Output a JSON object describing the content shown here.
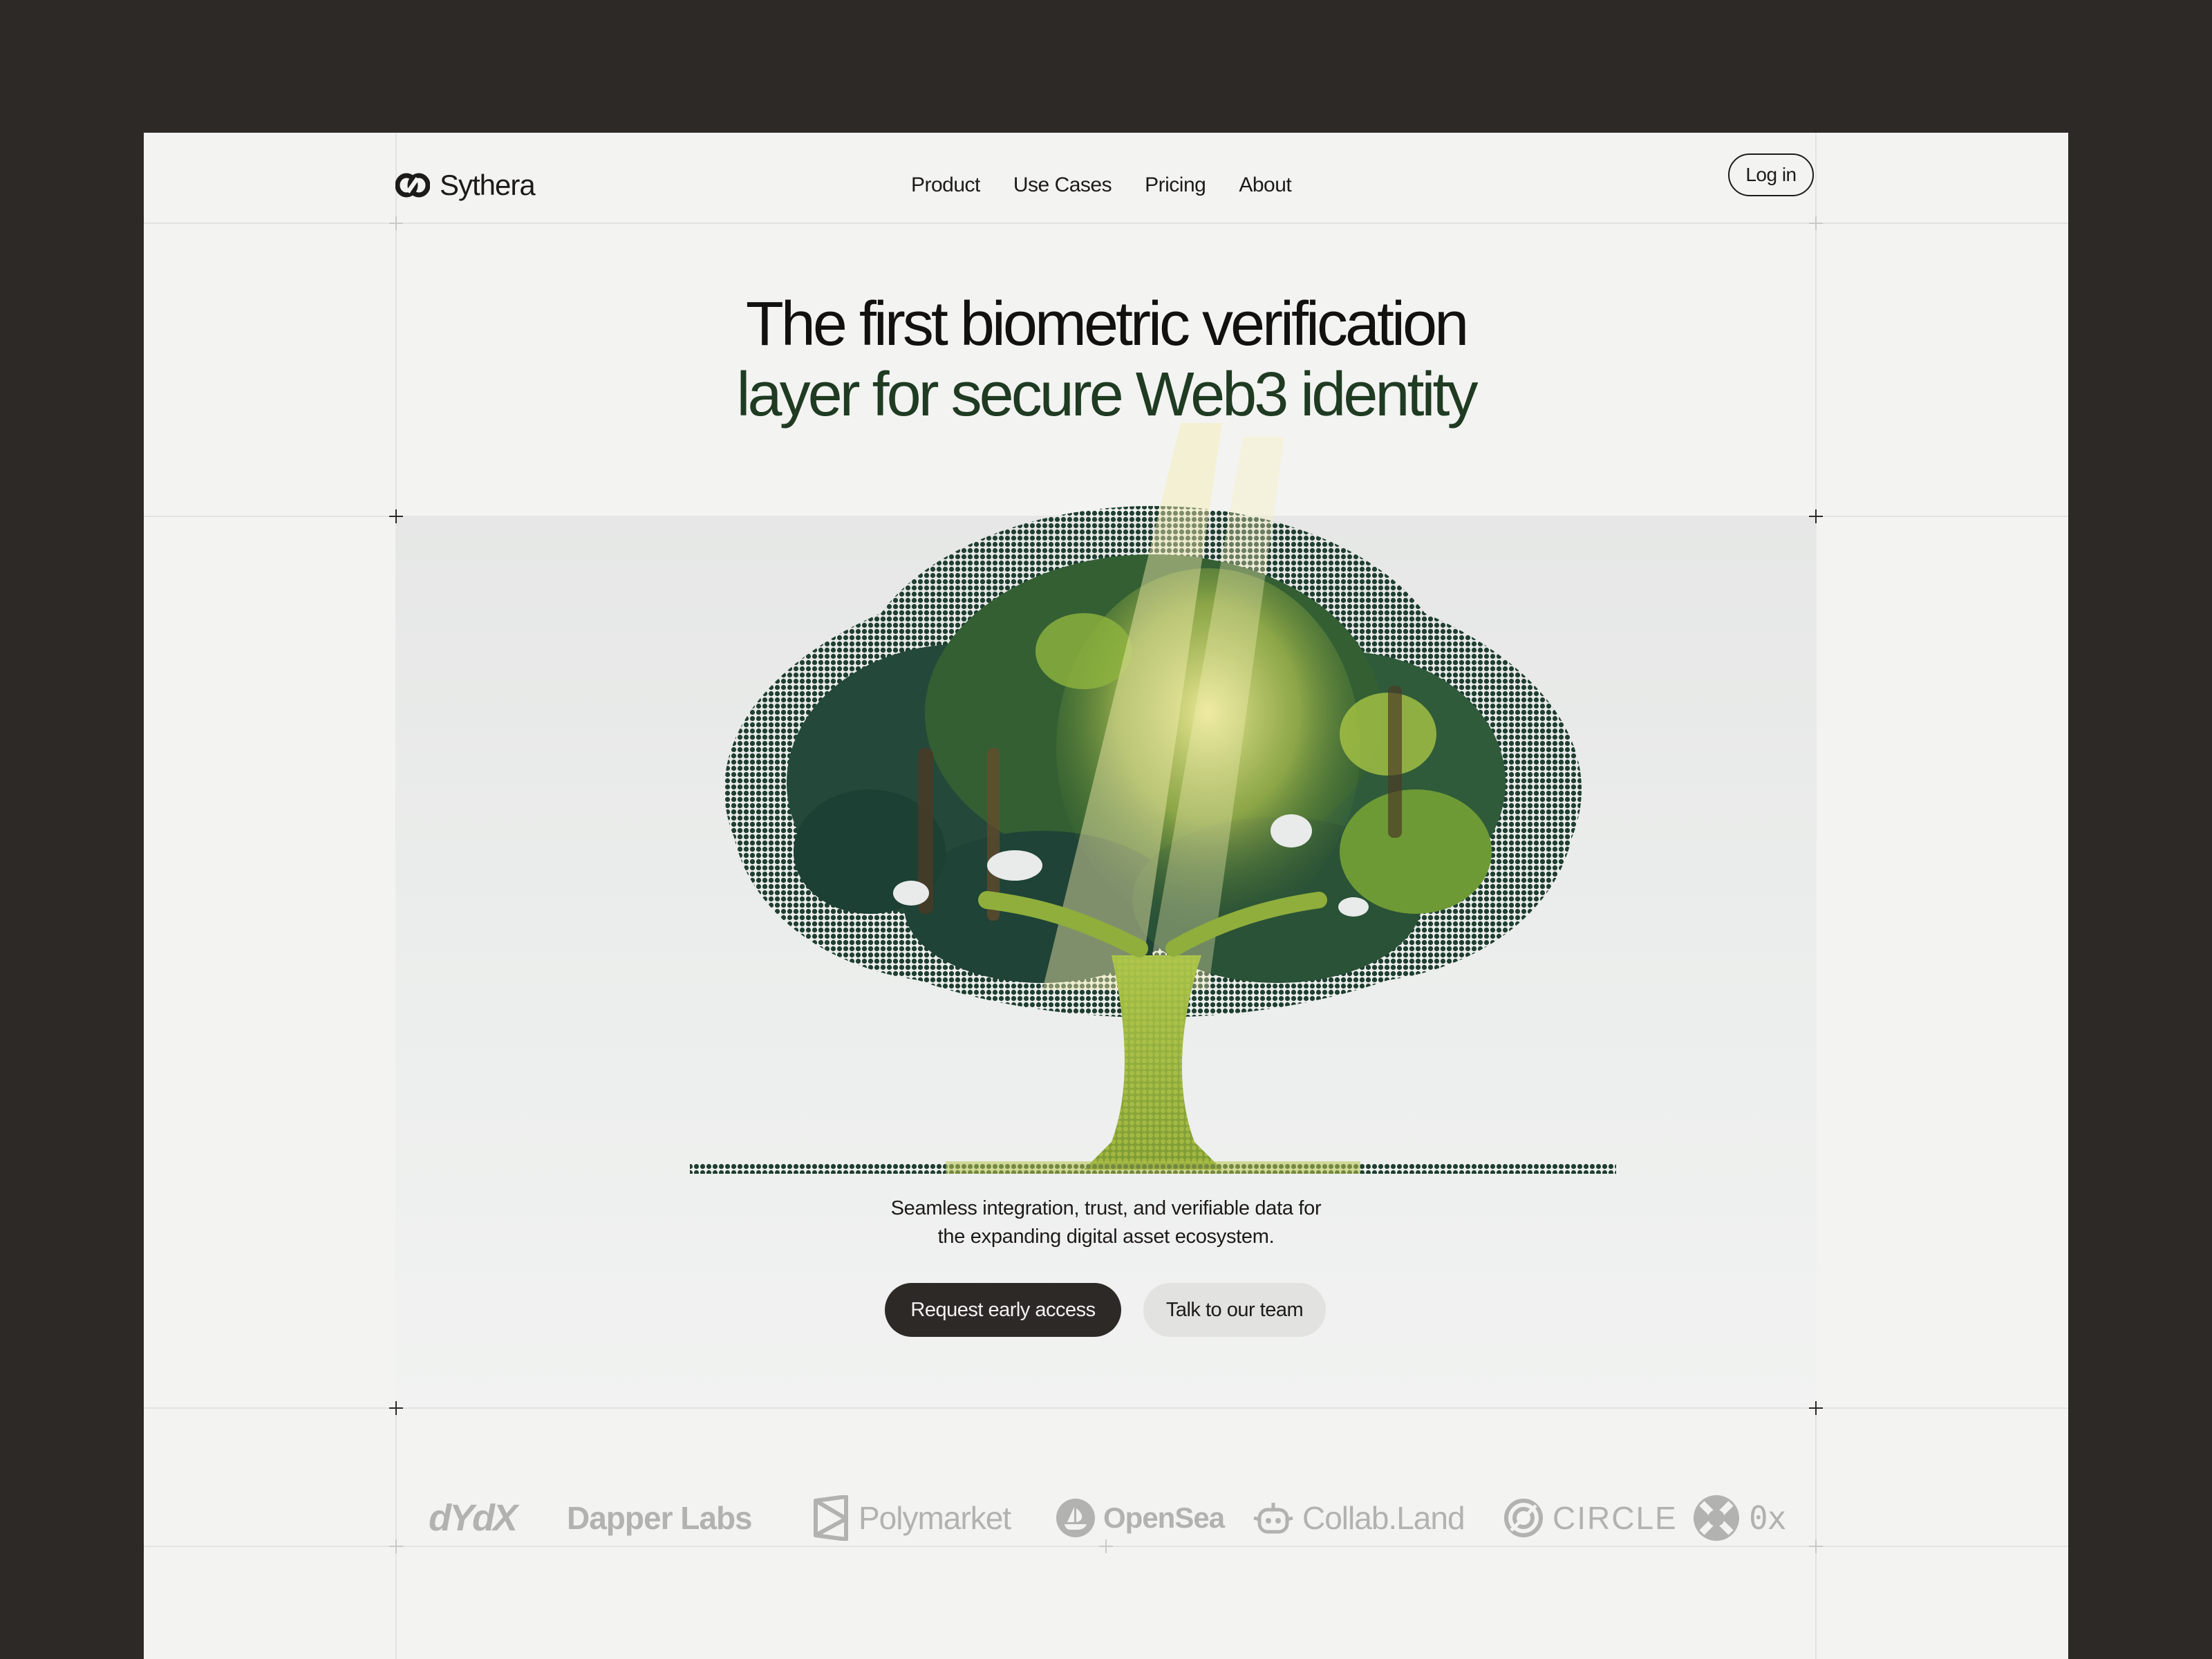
{
  "brand": {
    "name": "Sythera",
    "logo_icon": "linked-chain-icon"
  },
  "nav": {
    "items": [
      {
        "label": "Product"
      },
      {
        "label": "Use Cases"
      },
      {
        "label": "Pricing"
      },
      {
        "label": "About"
      }
    ],
    "login_label": "Log in"
  },
  "hero": {
    "headline_line1": "The first biometric verification",
    "headline_line2": "layer for secure Web3 identity",
    "image": "halftone-tree-illustration",
    "subtext_line1": "Seamless integration, trust, and verifiable data for",
    "subtext_line2": "the expanding digital asset ecosystem.",
    "primary_cta": "Request early access",
    "secondary_cta": "Talk to our team"
  },
  "partners": [
    {
      "name": "dYdX"
    },
    {
      "name": "Dapper Labs"
    },
    {
      "name": "Polymarket"
    },
    {
      "name": "OpenSea"
    },
    {
      "name": "Collab.Land"
    },
    {
      "name": "CIRCLE"
    },
    {
      "name": "0x"
    }
  ],
  "colors": {
    "frame": "#2d2926",
    "page": "#f3f3f2",
    "ink": "#1d1b19",
    "headline_accent": "#1f3b22",
    "partner_logo": "#b2b2b0"
  }
}
